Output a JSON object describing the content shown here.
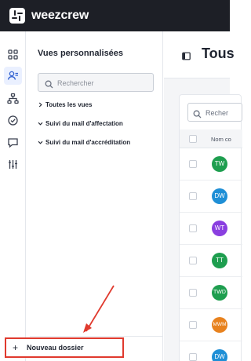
{
  "app": {
    "brand": "weezcrew",
    "colors": {
      "topbar": "#1d1f26",
      "accent": "#2f5fd0",
      "highlight": "#e03a2e"
    }
  },
  "rail": {
    "items": [
      {
        "icon": "dashboard-grid-icon",
        "active": false
      },
      {
        "icon": "users-icon",
        "active": true
      },
      {
        "icon": "org-chart-icon",
        "active": false
      },
      {
        "icon": "check-circle-icon",
        "active": false
      },
      {
        "icon": "chat-icon",
        "active": false
      },
      {
        "icon": "settings-sliders-icon",
        "active": false
      }
    ],
    "bottom_icon": "sidebar-toggle-icon"
  },
  "panel": {
    "title": "Vues personnalisées",
    "search_placeholder": "Rechercher",
    "tree": [
      {
        "label": "Toutes les vues",
        "chevron": "right-icon"
      },
      {
        "label": "Suivi du mail d'affectation",
        "chevron": "down-icon"
      },
      {
        "label": "Suivi du mail d'accréditation",
        "chevron": "down-icon"
      }
    ],
    "new_folder": {
      "plus": "+",
      "label": "Nouveau dossier"
    }
  },
  "main": {
    "title": "Tous",
    "search_placeholder": "Recher",
    "column_name": "Nom co",
    "rows": [
      {
        "initials": "TW",
        "color": "#1e9e4f"
      },
      {
        "initials": "DW",
        "color": "#1f8fd6"
      },
      {
        "initials": "WT",
        "color": "#8a3fe0"
      },
      {
        "initials": "TT",
        "color": "#1e9e4f"
      },
      {
        "initials": "TWD",
        "color": "#1e9e4f"
      },
      {
        "initials": "MWM",
        "color": "#e8821e"
      },
      {
        "initials": "DW",
        "color": "#1f8fd6"
      }
    ]
  }
}
